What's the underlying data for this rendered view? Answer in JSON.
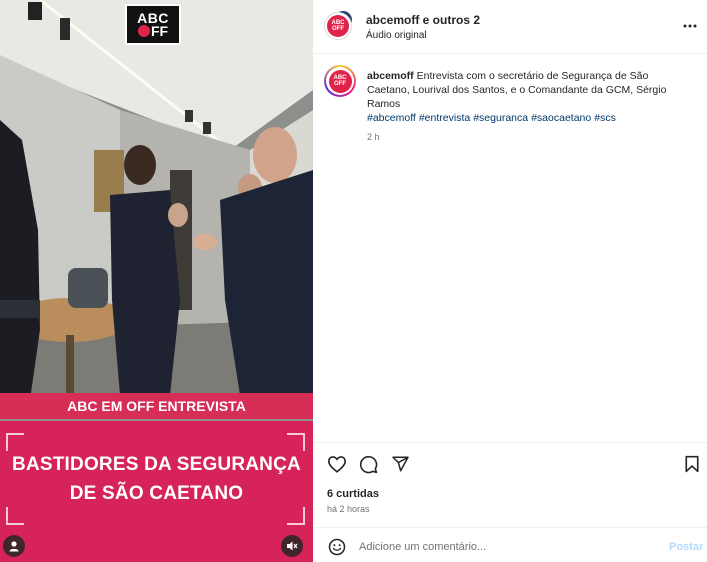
{
  "media": {
    "logo_line1": "ABC",
    "logo_line2": "FF",
    "strip_text": "ABC EM OFF ENTREVISTA",
    "banner_line1": "BASTIDORES DA SEGURANÇA",
    "banner_line2": "DE SÃO CAETANO",
    "user_icon": "user-icon",
    "mute_icon": "muted-speaker-icon"
  },
  "header": {
    "username": "abcemoff e outros 2",
    "audio": "Áudio original",
    "more_icon": "more-horizontal-icon"
  },
  "caption": {
    "username": "abcemoff",
    "text": "Entrevista com o secretário de Segurança de São Caetano, Lourival dos Santos, e o Comandante da GCM, Sérgio Ramos",
    "hashtags": [
      "#abcemoff",
      "#entrevista",
      "#seguranca",
      "#saocaetano",
      "#scs"
    ],
    "age": "2 h"
  },
  "actions": {
    "likes": "6 curtidas",
    "time": "há 2 horas"
  },
  "comment": {
    "placeholder": "Adicione um comentário...",
    "post_label": "Postar"
  },
  "colors": {
    "brand_pink": "#d6245a",
    "link_blue": "#00376b",
    "post_disabled": "#b3dbff"
  }
}
